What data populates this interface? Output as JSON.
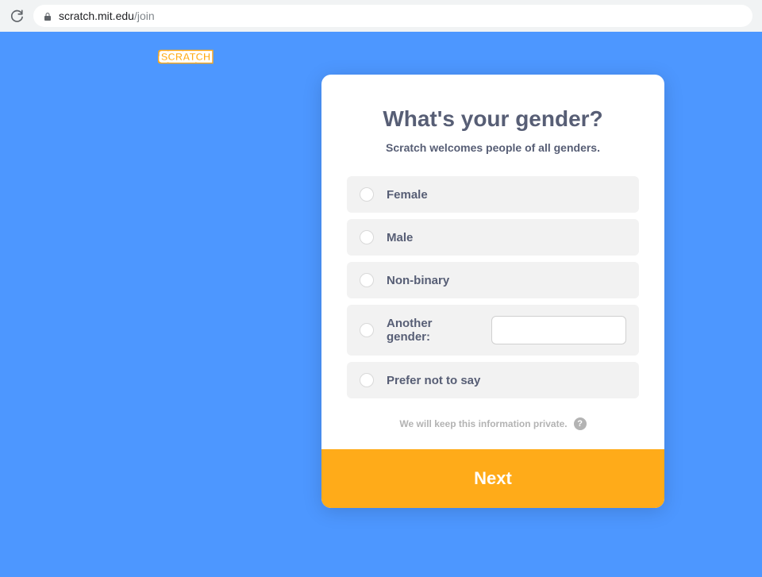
{
  "browser": {
    "url_domain": "scratch.mit.edu",
    "url_path": "/join"
  },
  "logo": {
    "text": "SCRATCH"
  },
  "modal": {
    "title": "What's your gender?",
    "subtitle": "Scratch welcomes people of all genders.",
    "options": {
      "female": "Female",
      "male": "Male",
      "nonbinary": "Non-binary",
      "another": "Another gender:",
      "prefer_not": "Prefer not to say"
    },
    "another_value": "",
    "privacy_text": "We will keep this information private.",
    "help_symbol": "?",
    "next_label": "Next"
  }
}
